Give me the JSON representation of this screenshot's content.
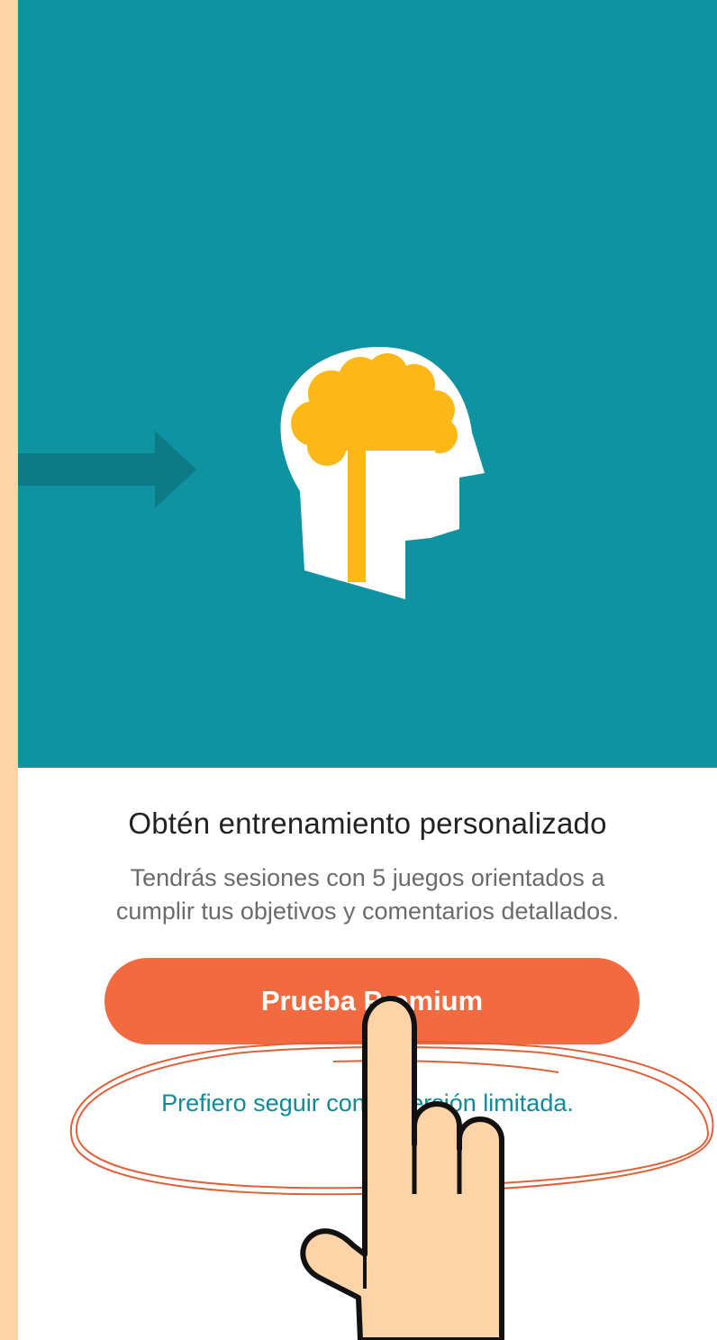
{
  "screen": {
    "title": "Obtén entrenamiento personalizado",
    "description_lines": [
      "Tendrás sesiones con 5 juegos orientados a",
      "cumplir tus objetivos y comentarios detallados."
    ],
    "primary_button_label": "Prueba Premium",
    "secondary_link_label": "Prefiero seguir con la versión limitada."
  },
  "icons": {
    "logo": "head-brain-tree-logo",
    "arrow": "arrow-right-icon",
    "pointer": "pointing-hand-icon"
  },
  "colors": {
    "hero_background": "#0f93a0",
    "page_border": "#fdd3a8",
    "primary_button": "#f26a3f",
    "link_text": "#0f8b98",
    "logo_yellow": "#fcb817",
    "annotation_stroke": "#e0603a"
  }
}
